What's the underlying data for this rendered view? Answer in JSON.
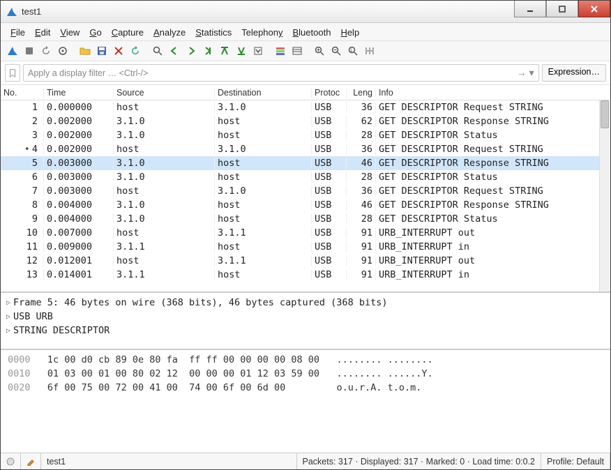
{
  "window": {
    "title": "test1"
  },
  "menu": {
    "file": {
      "pre": "",
      "u": "F",
      "rest": "ile"
    },
    "edit": {
      "pre": "",
      "u": "E",
      "rest": "dit"
    },
    "view": {
      "pre": "",
      "u": "V",
      "rest": "iew"
    },
    "go": {
      "pre": "",
      "u": "G",
      "rest": "o"
    },
    "capture": {
      "pre": "",
      "u": "C",
      "rest": "apture"
    },
    "analyze": {
      "pre": "",
      "u": "A",
      "rest": "nalyze"
    },
    "stats": {
      "pre": "",
      "u": "S",
      "rest": "tatistics"
    },
    "tel": {
      "pre": "Telephon",
      "u": "y",
      "rest": ""
    },
    "bt": {
      "pre": "",
      "u": "B",
      "rest": "luetooth"
    },
    "help": {
      "pre": "",
      "u": "H",
      "rest": "elp"
    }
  },
  "filter": {
    "placeholder": "Apply a display filter … <Ctrl-/>",
    "expression": "Expression…"
  },
  "columns": {
    "no": "No.",
    "time": "Time",
    "source": "Source",
    "destination": "Destination",
    "protocol": "Protoc",
    "length": "Leng",
    "info": "Info"
  },
  "packets": [
    {
      "marker": "",
      "no": "1",
      "time": "0.000000",
      "src": "host",
      "dst": "3.1.0",
      "prot": "USB",
      "len": "36",
      "info": "GET DESCRIPTOR Request STRING",
      "sel": false
    },
    {
      "marker": "",
      "no": "2",
      "time": "0.002000",
      "src": "3.1.0",
      "dst": "host",
      "prot": "USB",
      "len": "62",
      "info": "GET DESCRIPTOR Response STRING",
      "sel": false
    },
    {
      "marker": "",
      "no": "3",
      "time": "0.002000",
      "src": "3.1.0",
      "dst": "host",
      "prot": "USB",
      "len": "28",
      "info": "GET DESCRIPTOR Status",
      "sel": false
    },
    {
      "marker": "•",
      "no": "4",
      "time": "0.002000",
      "src": "host",
      "dst": "3.1.0",
      "prot": "USB",
      "len": "36",
      "info": "GET DESCRIPTOR Request STRING",
      "sel": false
    },
    {
      "marker": "",
      "no": "5",
      "time": "0.003000",
      "src": "3.1.0",
      "dst": "host",
      "prot": "USB",
      "len": "46",
      "info": "GET DESCRIPTOR Response STRING",
      "sel": true
    },
    {
      "marker": "",
      "no": "6",
      "time": "0.003000",
      "src": "3.1.0",
      "dst": "host",
      "prot": "USB",
      "len": "28",
      "info": "GET DESCRIPTOR Status",
      "sel": false
    },
    {
      "marker": "",
      "no": "7",
      "time": "0.003000",
      "src": "host",
      "dst": "3.1.0",
      "prot": "USB",
      "len": "36",
      "info": "GET DESCRIPTOR Request STRING",
      "sel": false
    },
    {
      "marker": "",
      "no": "8",
      "time": "0.004000",
      "src": "3.1.0",
      "dst": "host",
      "prot": "USB",
      "len": "46",
      "info": "GET DESCRIPTOR Response STRING",
      "sel": false
    },
    {
      "marker": "",
      "no": "9",
      "time": "0.004000",
      "src": "3.1.0",
      "dst": "host",
      "prot": "USB",
      "len": "28",
      "info": "GET DESCRIPTOR Status",
      "sel": false
    },
    {
      "marker": "",
      "no": "10",
      "time": "0.007000",
      "src": "host",
      "dst": "3.1.1",
      "prot": "USB",
      "len": "91",
      "info": "URB_INTERRUPT out",
      "sel": false
    },
    {
      "marker": "",
      "no": "11",
      "time": "0.009000",
      "src": "3.1.1",
      "dst": "host",
      "prot": "USB",
      "len": "91",
      "info": "URB_INTERRUPT in",
      "sel": false
    },
    {
      "marker": "",
      "no": "12",
      "time": "0.012001",
      "src": "host",
      "dst": "3.1.1",
      "prot": "USB",
      "len": "91",
      "info": "URB_INTERRUPT out",
      "sel": false
    },
    {
      "marker": "",
      "no": "13",
      "time": "0.014001",
      "src": "3.1.1",
      "dst": "host",
      "prot": "USB",
      "len": "91",
      "info": "URB_INTERRUPT in",
      "sel": false
    }
  ],
  "details": {
    "l1": "Frame 5: 46 bytes on wire (368 bits), 46 bytes captured (368 bits)",
    "l2": "USB URB",
    "l3": "STRING DESCRIPTOR"
  },
  "hex": {
    "r0": {
      "off": "0000",
      "b": "1c 00 d0 cb 89 0e 80 fa  ff ff 00 00 00 00 08 00",
      "a": "........ ........"
    },
    "r1": {
      "off": "0010",
      "b": "01 03 00 01 00 80 02 12  00 00 00 01 12 03 59 00",
      "a": "........ ......Y."
    },
    "r2": {
      "off": "0020",
      "b": "6f 00 75 00 72 00 41 00  74 00 6f 00 6d 00      ",
      "a": "o.u.r.A. t.o.m."
    }
  },
  "status": {
    "file": "test1",
    "stats": "Packets: 317 · Displayed: 317 · Marked: 0 · Load time: 0:0.2",
    "profile": "Profile: Default"
  }
}
